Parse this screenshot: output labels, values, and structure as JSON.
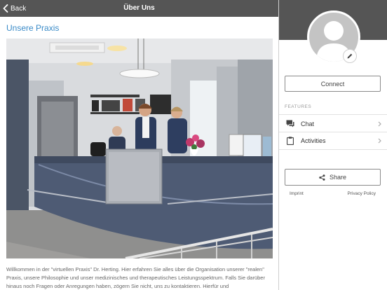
{
  "topbar": {
    "back_label": "Back",
    "title": "Über Uns"
  },
  "content": {
    "heading": "Unsere Praxis",
    "photo_icon": "reception-photo",
    "intro_text": "Willkommen in der \"virtuellen Praxis\" Dr. Herting. Hier erfahren Sie alles über die Organisation unserer \"realen\" Praxis, unsere Philosophie und unser medizinisches und therapeutisches Leistungsspektrum. Falls Sie darüber hinaus noch Fragen oder Anregungen haben, zögern Sie nicht, uns zu kontaktieren. Hierfür und"
  },
  "sidebar": {
    "avatar_icon": "user-avatar-placeholder",
    "edit_icon": "pencil-icon",
    "connect_label": "Connect",
    "features_label": "FEATURES",
    "features": [
      {
        "label": "Chat",
        "icon": "chat-icon"
      },
      {
        "label": "Activities",
        "icon": "clipboard-icon"
      }
    ],
    "share_label": "Share",
    "share_icon": "share-icon",
    "imprint_label": "Imprint",
    "privacy_label": "Privacy Policy"
  },
  "colors": {
    "header_bg": "#555555",
    "accent_heading": "#3a8bc8",
    "border": "#8a8a8a"
  }
}
